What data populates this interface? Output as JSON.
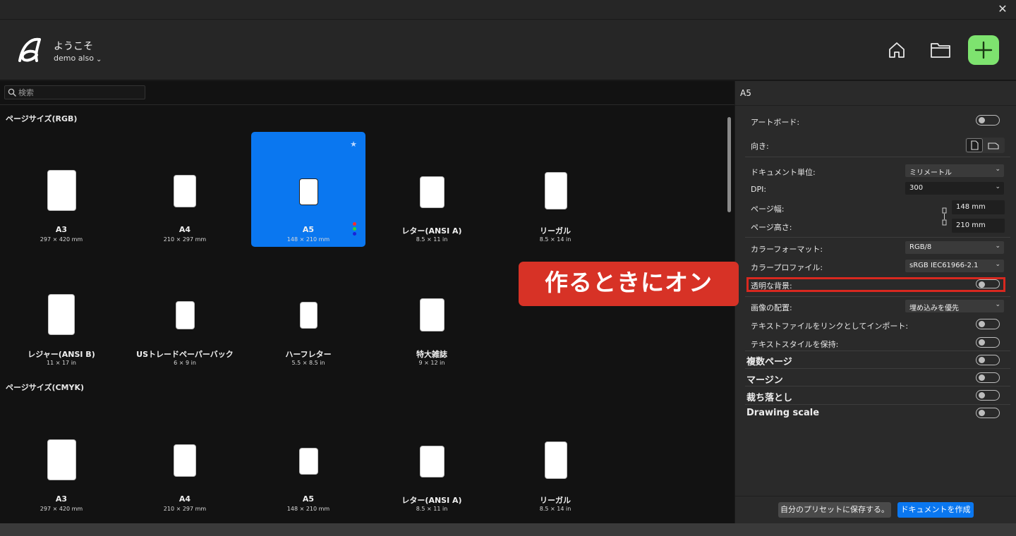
{
  "header": {
    "welcome": "ようこそ",
    "user": "demo also",
    "colors": {
      "new_button": "#7ee36f",
      "accent": "#0a77f0"
    }
  },
  "search": {
    "placeholder": "検索"
  },
  "sections": {
    "rgb_title": "ページサイズ(RGB)",
    "cmyk_title": "ページサイズ(CMYK)"
  },
  "presets_rgb": [
    {
      "name": "A3",
      "size": "297 × 420 mm"
    },
    {
      "name": "A4",
      "size": "210 × 297 mm"
    },
    {
      "name": "A5",
      "size": "148 × 210 mm",
      "selected": true
    },
    {
      "name": "レター(ANSI A)",
      "size": "8.5 × 11 in"
    },
    {
      "name": "リーガル",
      "size": "8.5 × 14 in"
    },
    {
      "name": "レジャー(ANSI B)",
      "size": "11 × 17 in"
    },
    {
      "name": "USトレードペーパーバック",
      "size": "6 × 9 in"
    },
    {
      "name": "ハーフレター",
      "size": "5.5 × 8.5 in"
    },
    {
      "name": "特大雑誌",
      "size": "9 × 12 in"
    }
  ],
  "presets_cmyk": [
    {
      "name": "A3",
      "size": "297 × 420 mm"
    },
    {
      "name": "A4",
      "size": "210 × 297 mm"
    },
    {
      "name": "A5",
      "size": "148 × 210 mm"
    },
    {
      "name": "レター(ANSI A)",
      "size": "8.5 × 11 in"
    },
    {
      "name": "リーガル",
      "size": "8.5 × 14 in"
    }
  ],
  "panel": {
    "title": "A5",
    "artboard_label": "アートボード:",
    "orientation_label": "向き:",
    "doc_units_label": "ドキュメント単位:",
    "doc_units_value": "ミリメートル",
    "dpi_label": "DPI:",
    "dpi_value": "300",
    "page_width_label": "ページ幅:",
    "page_width_value": "148 mm",
    "page_height_label": "ページ高さ:",
    "page_height_value": "210 mm",
    "color_format_label": "カラーフォーマット:",
    "color_format_value": "RGB/8",
    "color_profile_label": "カラープロファイル:",
    "color_profile_value": "sRGB IEC61966-2.1",
    "transparent_bg_label": "透明な背景:",
    "image_placement_label": "画像の配置:",
    "image_placement_value": "埋め込みを優先",
    "import_text_link_label": "テキストファイルをリンクとしてインポート:",
    "keep_text_style_label": "テキストスタイルを保持:",
    "multi_page_label": "複数ページ",
    "margins_label": "マージン",
    "bleed_label": "裁ち落とし",
    "drawing_scale_label": "Drawing scale",
    "save_preset_button": "自分のプリセットに保存する。",
    "create_button": "ドキュメントを作成"
  },
  "callout": {
    "text": "作るときにオン",
    "color": "#d73226"
  }
}
